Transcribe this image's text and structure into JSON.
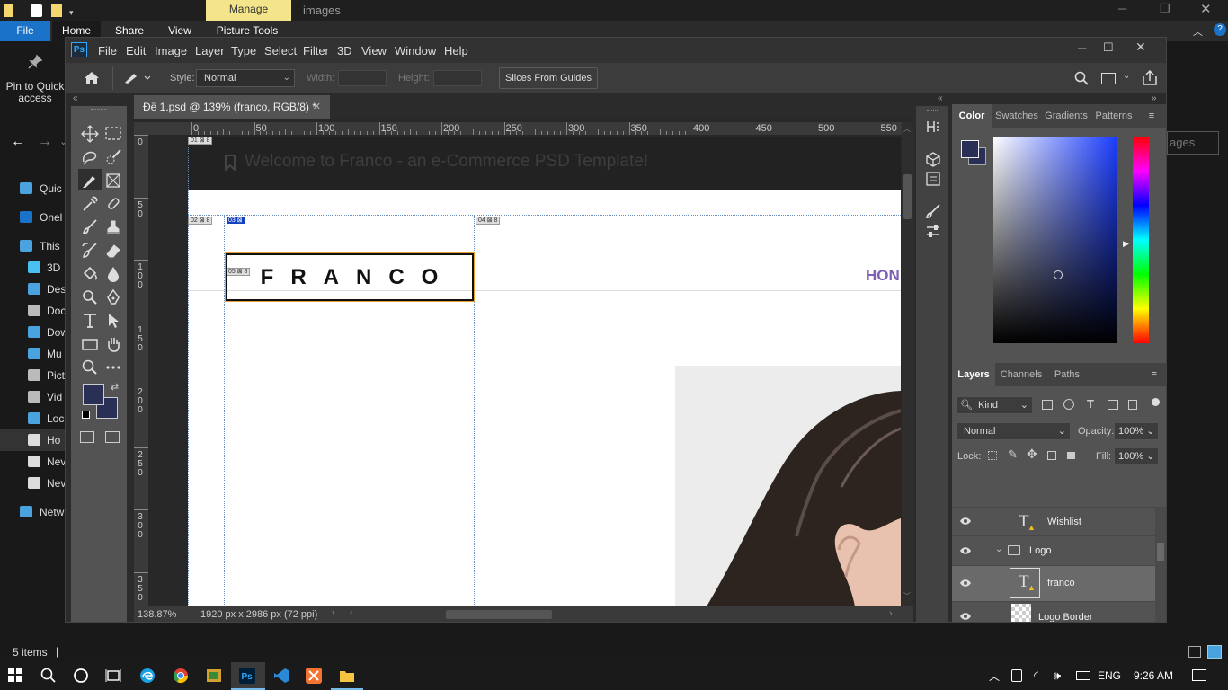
{
  "explorer": {
    "title_tab": "Manage",
    "title_text": "images",
    "ribbon_tabs": [
      "File",
      "Home",
      "Share",
      "View",
      "Picture Tools"
    ],
    "pin_label": "Pin to Quick access",
    "search_placeholder": "ages",
    "nav_items": [
      "Quic",
      "Onel",
      "This",
      "3D",
      "Des",
      "Doc",
      "Dow",
      "Mu",
      "Pict",
      "Vid",
      "Loc",
      "Ho",
      "Nev",
      "Nev",
      "Netw"
    ],
    "status": "5 items"
  },
  "ps": {
    "logo": "Ps",
    "menu": [
      "File",
      "Edit",
      "Image",
      "Layer",
      "Type",
      "Select",
      "Filter",
      "3D",
      "View",
      "Window",
      "Help"
    ],
    "options": {
      "style_label": "Style:",
      "style_value": "Normal",
      "width_label": "Width:",
      "height_label": "Height:",
      "slices_button": "Slices From Guides"
    },
    "doc_tab": "Đề 1.psd @ 139% (franco, RGB/8) *",
    "ruler_top": [
      "0",
      "50",
      "100",
      "150",
      "200",
      "250",
      "300",
      "350",
      "400",
      "450",
      "500",
      "550"
    ],
    "ruler_left": [
      "0",
      "5\n0",
      "1\n0\n0",
      "1\n5\n0",
      "2\n0\n0",
      "2\n5\n0",
      "3\n0\n0",
      "3\n5\n0"
    ],
    "status_zoom": "138.87%",
    "status_size": "1920 px x 2986 px (72 ppi)",
    "canvas": {
      "banner_text": "Welcome to Franco - an e-Commerce PSD Template!",
      "logo_text": "FRANCO",
      "nav_text": "HON",
      "slice_labels": [
        "01",
        "02",
        "03",
        "04",
        "05"
      ]
    },
    "color_panel": {
      "tabs": [
        "Color",
        "Swatches",
        "Gradients",
        "Patterns"
      ],
      "foreground": "#2a2f55",
      "background": "#2a2f55"
    },
    "layers_panel": {
      "tabs": [
        "Layers",
        "Channels",
        "Paths"
      ],
      "filter_kind": "Kind",
      "blend_mode": "Normal",
      "opacity_label": "Opacity:",
      "opacity_value": "100%",
      "lock_label": "Lock:",
      "fill_label": "Fill:",
      "fill_value": "100%",
      "layers": [
        {
          "name": "Wishlist",
          "type": "text"
        },
        {
          "name": "Logo",
          "type": "group"
        },
        {
          "name": "franco",
          "type": "text",
          "selected": true
        },
        {
          "name": "Logo Border",
          "type": "pixel"
        }
      ]
    }
  },
  "taskbar": {
    "lang": "ENG",
    "time": "9:26 AM"
  }
}
